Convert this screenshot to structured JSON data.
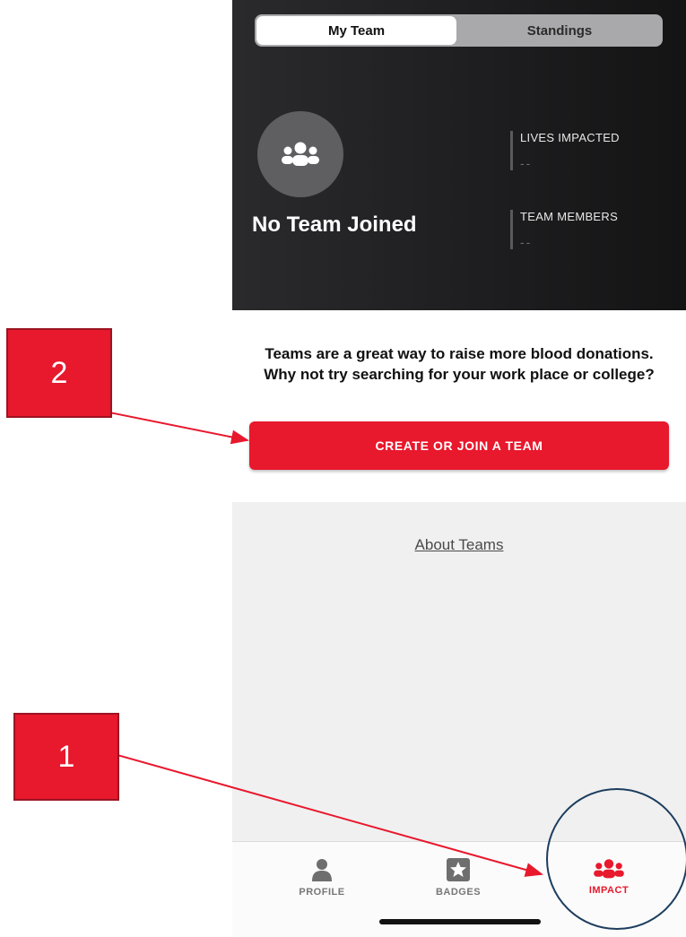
{
  "segmented": {
    "active": "My Team",
    "inactive": "Standings"
  },
  "team": {
    "name": "No Team Joined",
    "avatar_icon": "team-icon"
  },
  "stats": [
    {
      "label": "LIVES IMPACTED",
      "value": "--"
    },
    {
      "label": "TEAM MEMBERS",
      "value": "--"
    }
  ],
  "message": "Teams are a great way to raise more blood donations. Why not try searching for your work place or college?",
  "cta_label": "CREATE OR JOIN A TEAM",
  "about_link": "About Teams",
  "tabbar": [
    {
      "label": "PROFILE",
      "icon": "person-icon",
      "active": false
    },
    {
      "label": "BADGES",
      "icon": "star-badge-icon",
      "active": false
    },
    {
      "label": "IMPACT",
      "icon": "team-icon",
      "active": true
    }
  ],
  "annotations": [
    {
      "number": "1"
    },
    {
      "number": "2"
    }
  ],
  "colors": {
    "accent": "#e8182d",
    "hero_dark": "#1f1f21"
  }
}
